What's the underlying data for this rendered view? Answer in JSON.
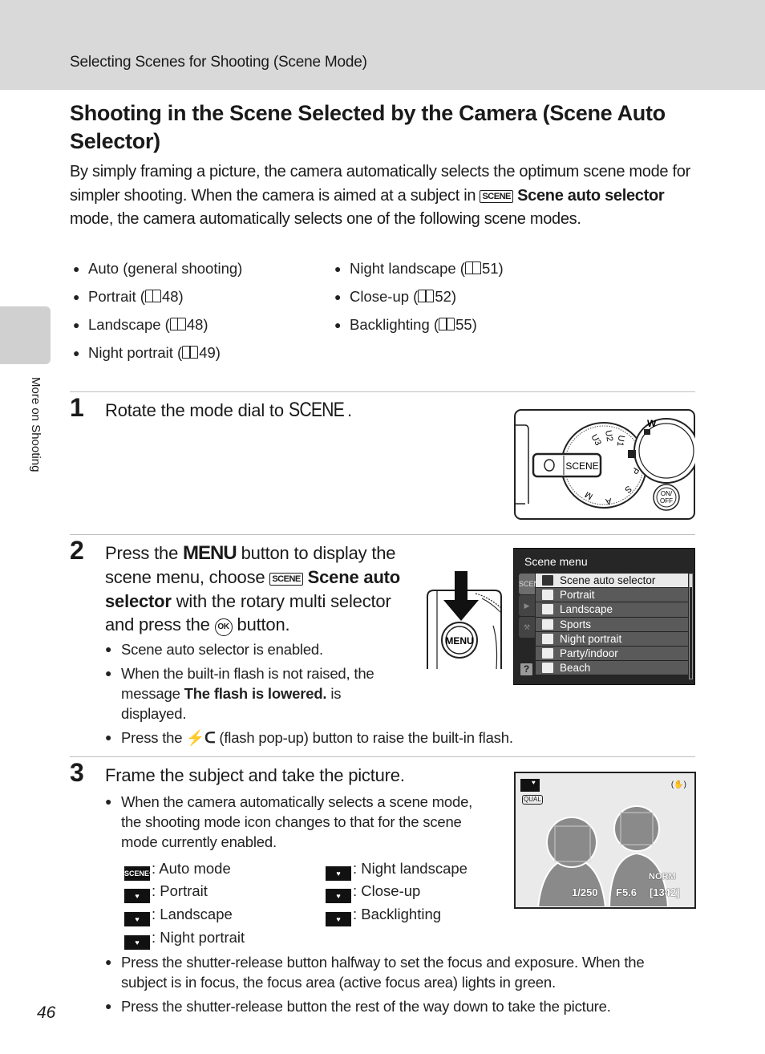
{
  "header": {
    "breadcrumb": "Selecting Scenes for Shooting (Scene Mode)"
  },
  "side_tab": {
    "label": "More on Shooting"
  },
  "title": "Shooting in the Scene Selected by the Camera (Scene Auto Selector)",
  "intro": {
    "part1": "By simply framing a picture, the camera automatically selects the optimum scene mode for simpler shooting. When the camera is aimed at a subject in ",
    "icon": "SCENE",
    "bold": "Scene auto selector",
    "part2": " mode, the camera automatically selects one of the following scene modes."
  },
  "scene_modes": {
    "left": [
      {
        "label": "Auto (general shooting)",
        "page": ""
      },
      {
        "label": "Portrait (",
        "page": "48)"
      },
      {
        "label": "Landscape (",
        "page": "48)"
      },
      {
        "label": "Night portrait (",
        "page": "49)"
      }
    ],
    "right": [
      {
        "label": "Night landscape (",
        "page": "51)"
      },
      {
        "label": "Close-up (",
        "page": "52)"
      },
      {
        "label": "Backlighting (",
        "page": "55)"
      }
    ]
  },
  "steps": [
    {
      "number": "1",
      "text_before": "Rotate the mode dial to ",
      "dial_label": "SCENE",
      "text_after": "."
    },
    {
      "number": "2",
      "t1": "Press the ",
      "menu": "MENU",
      "t2": " button to display the scene menu, choose ",
      "icon": "SCENE",
      "bold": "Scene auto selector",
      "t3": " with the rotary multi selector and press the ",
      "ok": "OK",
      "t4": " button.",
      "bullets": [
        {
          "text": "Scene auto selector is enabled."
        },
        {
          "pre": "When the built-in flash is not raised, the message ",
          "bold": "The flash is lowered.",
          "post": " is displayed."
        },
        {
          "pre": "Press the ",
          "icon": "⚡ᑕ",
          "post": " (flash pop-up) button to raise the built-in flash."
        }
      ]
    },
    {
      "number": "3",
      "text": "Frame the subject and take the picture.",
      "bullet1": "When the camera automatically selects a scene mode, the shooting mode icon changes to that for the scene mode currently enabled.",
      "legend": [
        {
          "icon": "SCENE♥",
          "label": ": Auto mode"
        },
        {
          "icon": "♥",
          "label": ": Portrait"
        },
        {
          "icon": "♥",
          "label": ": Landscape"
        },
        {
          "icon": "♥",
          "label": ": Night portrait"
        },
        {
          "icon": "♥",
          "label": ": Night landscape"
        },
        {
          "icon": "♥",
          "label": ": Close-up"
        },
        {
          "icon": "♥",
          "label": ": Backlighting"
        }
      ],
      "bullets_after": [
        "Press the shutter-release button halfway to set the focus and exposure. When the subject is in focus, the focus area (active focus area) lights in green.",
        "Press the shutter-release button the rest of the way down to take the picture."
      ]
    }
  ],
  "dial_illustration": {
    "scene_label": "SCENE",
    "on_off": "ON/\nOFF",
    "zoom_w": "W",
    "dial_marks": [
      "U3",
      "U2",
      "U1",
      "P",
      "S",
      "A",
      "M"
    ]
  },
  "menu_button_label": "MENU",
  "scene_menu": {
    "title": "Scene menu",
    "side_tabs": [
      "SCENE",
      "▶",
      "⚒"
    ],
    "help": "?",
    "items": [
      {
        "label": "Scene auto selector",
        "selected": true
      },
      {
        "label": "Portrait",
        "selected": false
      },
      {
        "label": "Landscape",
        "selected": false
      },
      {
        "label": "Sports",
        "selected": false
      },
      {
        "label": "Night portrait",
        "selected": false
      },
      {
        "label": "Party/indoor",
        "selected": false
      },
      {
        "label": "Beach",
        "selected": false
      }
    ]
  },
  "lcd": {
    "mode_icon": "♥",
    "qual": "QUAL",
    "shutter": "1/250",
    "aperture": "F5.6",
    "remaining": "[1342]",
    "image_mode": "NORM",
    "vr_icon": "(✋)"
  },
  "page_number": "46"
}
